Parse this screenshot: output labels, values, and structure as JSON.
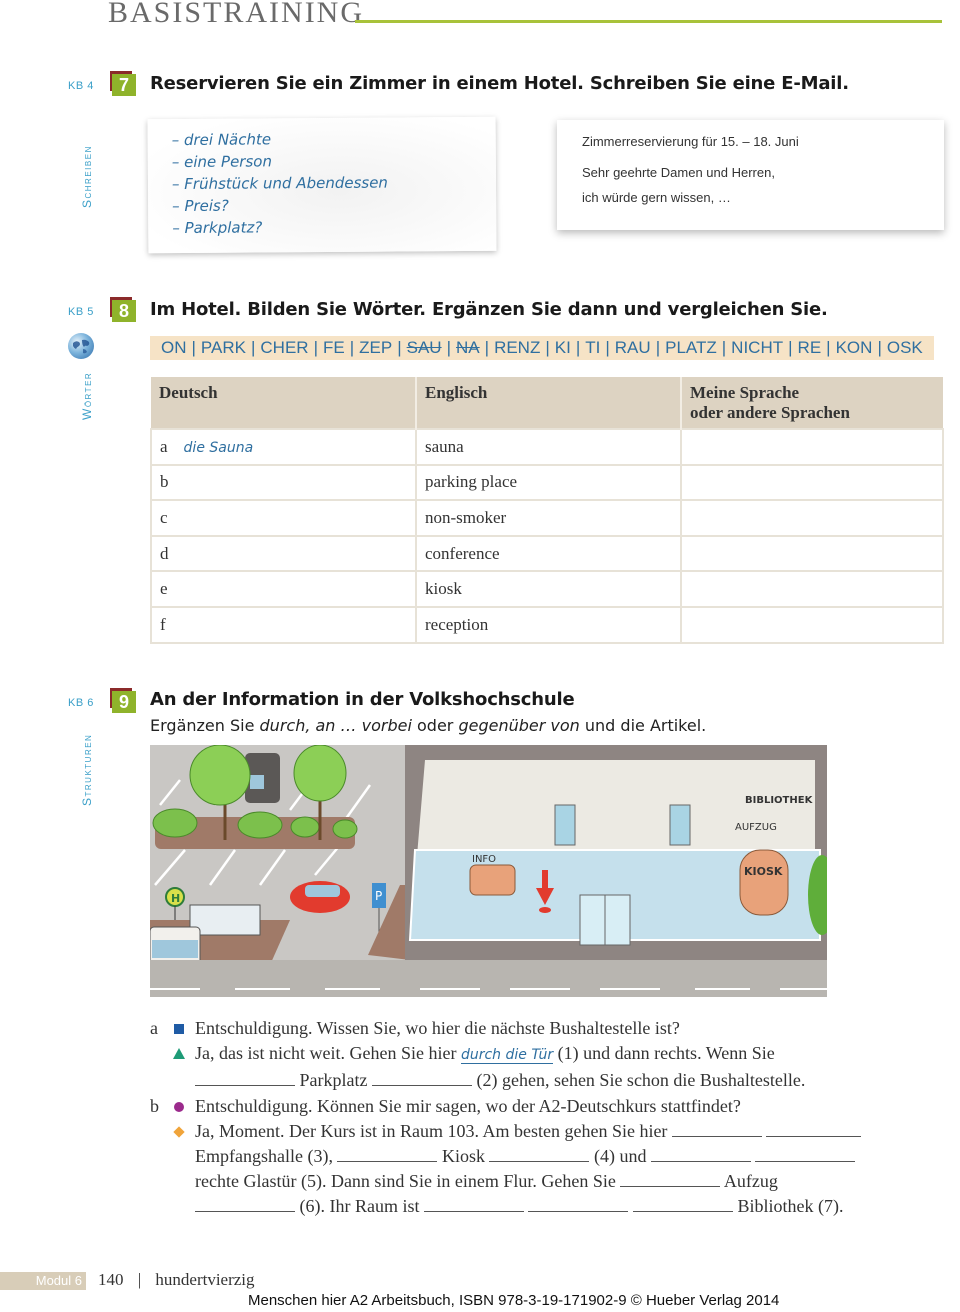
{
  "header": {
    "title": "BASISTRAINING",
    "accent_color": "#a8c23a"
  },
  "exercise7": {
    "kb_label": "KB 4",
    "number": "7",
    "title": "Reservieren Sie ein Zimmer in einem Hotel. Schreiben Sie eine E-Mail.",
    "side_label": "Schreiben",
    "note_lines": [
      "– drei Nächte",
      "– eine Person",
      "– Frühstück und Abendessen",
      "– Preis?",
      "– Parkplatz?"
    ],
    "email": {
      "subject": "Zimmerreservierung für 15. – 18. Juni",
      "greeting": "Sehr geehrte Damen und Herren,",
      "opening": "ich würde gern wissen, …"
    }
  },
  "exercise8": {
    "kb_label": "KB 5",
    "number": "8",
    "title": "Im Hotel. Bilden Sie Wörter. Ergänzen Sie dann und vergleichen Sie.",
    "side_label": "Wörter",
    "globe_icon": "globe-icon",
    "syllables": [
      {
        "text": "ON",
        "struck": false
      },
      {
        "text": "PARK",
        "struck": false
      },
      {
        "text": "CHER",
        "struck": false
      },
      {
        "text": "FE",
        "struck": false
      },
      {
        "text": "ZEP",
        "struck": false
      },
      {
        "text": "SAU",
        "struck": true
      },
      {
        "text": "NA",
        "struck": true
      },
      {
        "text": "RENZ",
        "struck": false
      },
      {
        "text": "KI",
        "struck": false
      },
      {
        "text": "TI",
        "struck": false
      },
      {
        "text": "RAU",
        "struck": false
      },
      {
        "text": "PLATZ",
        "struck": false
      },
      {
        "text": "NICHT",
        "struck": false
      },
      {
        "text": "RE",
        "struck": false
      },
      {
        "text": "KON",
        "struck": false
      },
      {
        "text": "OSK",
        "struck": false
      }
    ],
    "table": {
      "headers": [
        "Deutsch",
        "Englisch",
        "Meine Sprache oder andere Sprachen"
      ],
      "header3_line1": "Meine Sprache",
      "header3_line2": "oder andere Sprachen",
      "rows": [
        {
          "letter": "a",
          "deutsch": "die Sauna",
          "englisch": "sauna",
          "andere": ""
        },
        {
          "letter": "b",
          "deutsch": "",
          "englisch": "parking place",
          "andere": ""
        },
        {
          "letter": "c",
          "deutsch": "",
          "englisch": "non-smoker",
          "andere": ""
        },
        {
          "letter": "d",
          "deutsch": "",
          "englisch": "conference",
          "andere": ""
        },
        {
          "letter": "e",
          "deutsch": "",
          "englisch": "kiosk",
          "andere": ""
        },
        {
          "letter": "f",
          "deutsch": "",
          "englisch": "reception",
          "andere": ""
        }
      ]
    }
  },
  "exercise9": {
    "kb_label": "KB 6",
    "number": "9",
    "title": "An der Information in der Volkshochschule",
    "instruction_pre": "Ergänzen Sie ",
    "instruction_em1": "durch, an … vorbei",
    "instruction_mid": " oder ",
    "instruction_em2": "gegenüber von",
    "instruction_post": " und die Artikel.",
    "side_label": "Strukturen",
    "illustration_labels": {
      "library": "BIBLIOTHEK",
      "elevator": "AUFZUG",
      "info": "INFO",
      "kiosk": "KIOSK",
      "bus_stop": "H"
    },
    "dialog": {
      "a_letter": "a",
      "a_q": "Entschuldigung. Wissen Sie, wo hier die nächste Bushaltestelle ist?",
      "a_ans1_pre": "Ja, das ist nicht weit. Gehen Sie hier ",
      "a_ans1_filled": "durch die Tür",
      "a_ans1_post": " (1) und dann rechts. Wenn Sie",
      "a_ans2_mid": " Parkplatz ",
      "a_ans2_post": " (2) gehen, sehen Sie schon die Bushaltestelle.",
      "b_letter": "b",
      "b_q": "Entschuldigung. Können Sie mir sagen, wo der A2-Deutschkurs stattfindet?",
      "b_ans1": "Ja, Moment. Der Kurs ist in Raum 103. Am besten gehen Sie hier ",
      "b_ans2_a": "Empfangshalle (3), ",
      "b_ans2_b": " Kiosk ",
      "b_ans2_c": " (4) und ",
      "b_ans3_a": "rechte Glastür (5). Dann sind Sie in einem Flur. Gehen Sie ",
      "b_ans3_b": " Aufzug",
      "b_ans4_a": " (6). Ihr Raum ist ",
      "b_ans4_b": " Bibliothek (7)."
    }
  },
  "footer": {
    "module": "Modul 6",
    "page_number": "140",
    "page_word": "hundertvierzig",
    "copyright": "Menschen hier A2 Arbeitsbuch, ISBN 978-3-19-171902-9 © Hueber Verlag 2014"
  }
}
